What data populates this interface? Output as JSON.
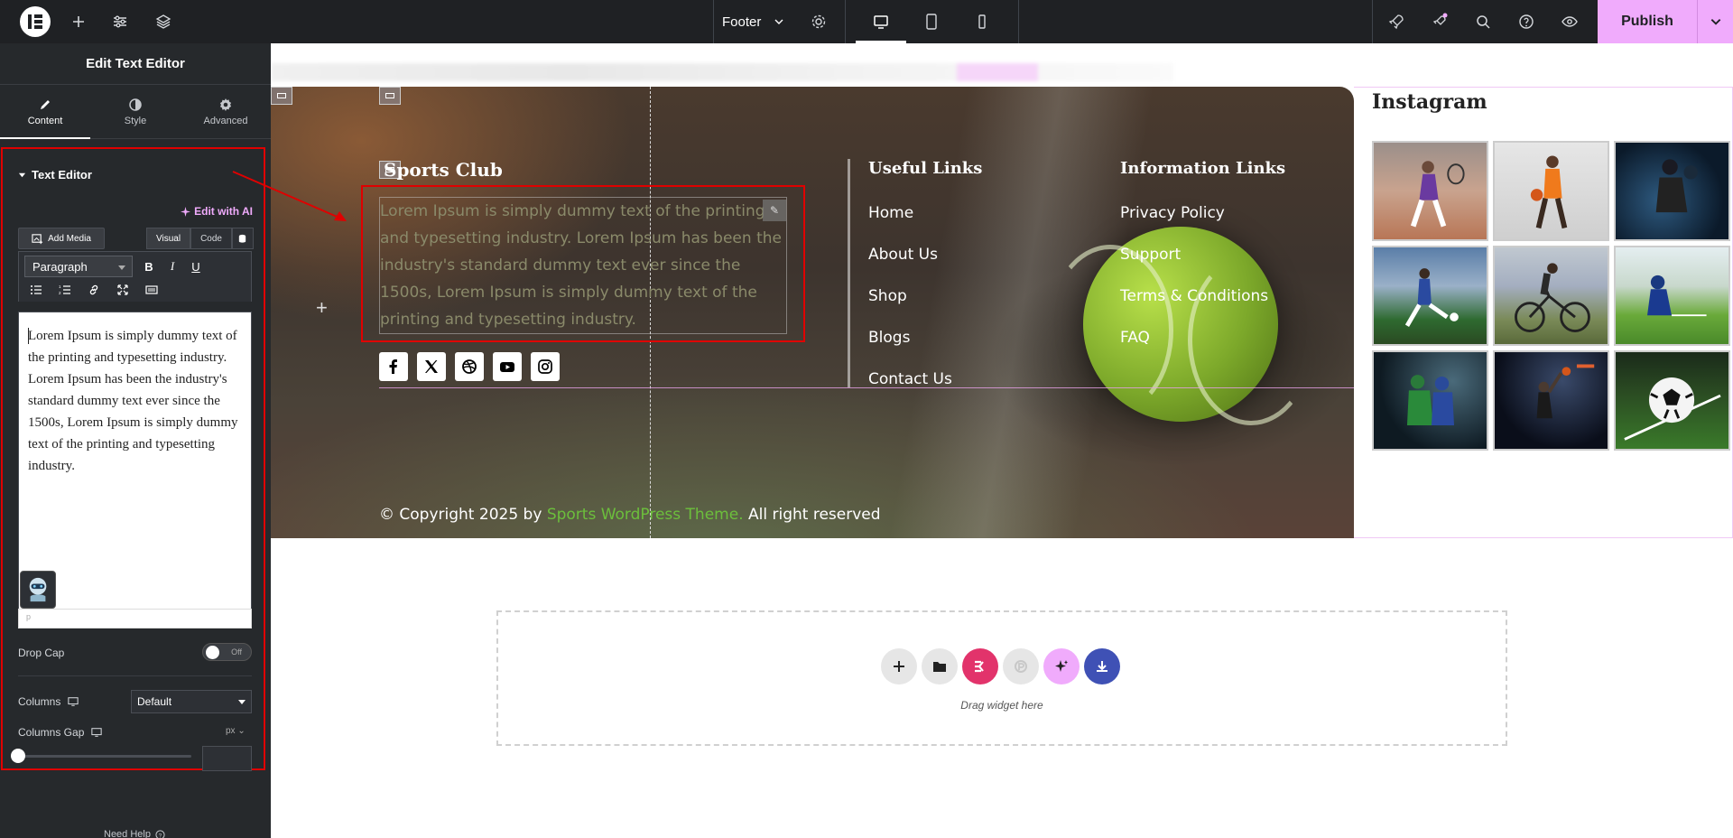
{
  "topbar": {
    "document_name": "Footer",
    "publish_label": "Publish"
  },
  "sidebar": {
    "title": "Edit Text Editor",
    "tabs": [
      {
        "label": "Content",
        "icon": "pencil-icon"
      },
      {
        "label": "Style",
        "icon": "half-circle-icon"
      },
      {
        "label": "Advanced",
        "icon": "gear-icon"
      }
    ],
    "section_title": "Text Editor",
    "edit_with_ai": "Edit with AI",
    "add_media": "Add Media",
    "mode_visual": "Visual",
    "mode_code": "Code",
    "format_select": "Paragraph",
    "editor_content": "Lorem Ipsum is simply dummy text of the printing and typesetting industry. Lorem Ipsum has been the industry's standard dummy text ever since the 1500s, Lorem Ipsum is simply dummy text of the printing and typesetting industry.",
    "editor_status": "p",
    "drop_cap_label": "Drop Cap",
    "drop_cap_state": "Off",
    "columns_label": "Columns",
    "columns_value": "Default",
    "columns_gap_label": "Columns Gap",
    "columns_gap_unit": "px",
    "need_help": "Need Help"
  },
  "canvas": {
    "club_title": "Sports Club",
    "club_text": "Lorem Ipsum is simply dummy text of the printing and typesetting industry. Lorem Ipsum has been the industry's standard dummy text ever since the 1500s, Lorem Ipsum is simply dummy text of the printing and typesetting industry.",
    "useful_links_title": "Useful Links",
    "useful_links": [
      "Home",
      "About Us",
      "Shop",
      "Blogs",
      "Contact Us"
    ],
    "info_links_title": "Information Links",
    "info_links": [
      "Privacy Policy",
      "Support",
      "Terms & Conditions",
      "FAQ"
    ],
    "copyright_prefix": "© Copyright 2025 by",
    "copyright_link": "Sports WordPress Theme.",
    "copyright_suffix": "All right reserved",
    "instagram_title": "Instagram",
    "drop_text": "Drag widget here"
  },
  "colors": {
    "accent": "#f0abfc",
    "highlight_red": "#e00000",
    "copyright_link": "#6cbf3c",
    "elementor_pink": "#e2336b",
    "import_blue": "#3f51b5"
  }
}
